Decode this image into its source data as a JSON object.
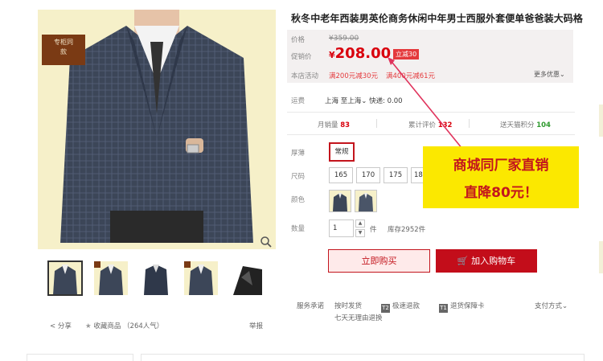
{
  "product": {
    "title": "秋冬中老年西装男英伦商务休闲中年男士西服外套便单爸爸装大码格",
    "promo_sticker_line1": "专柜同",
    "promo_sticker_line2": "款"
  },
  "price": {
    "orig_label": "价格",
    "orig_value": "¥359.00",
    "promo_label": "促销价",
    "currency": "¥",
    "promo_value": "208.00",
    "discount_badge": "立减30",
    "event_label": "本店活动",
    "event1": "满200元减30元",
    "event2": "满400元减61元",
    "more_deals": "更多优惠"
  },
  "shipping": {
    "label": "运费",
    "from": "上海",
    "to": "至上海",
    "express": "快递: 0.00"
  },
  "stats": {
    "monthly_sales_label": "月销量",
    "monthly_sales_value": "83",
    "reviews_label": "累计评价",
    "reviews_value": "132",
    "points_label": "送天猫积分",
    "points_value": "104"
  },
  "options": {
    "thickness_label": "厚薄",
    "thickness_value": "常规",
    "size_label": "尺码",
    "sizes": [
      "165",
      "170",
      "175",
      "18"
    ],
    "color_label": "颜色",
    "qty_label": "数量",
    "qty_value": "1",
    "qty_unit": "件",
    "stock": "库存2952件"
  },
  "actions": {
    "buy_now": "立即购买",
    "add_cart": "加入购物车"
  },
  "ad": {
    "line1": "商城同厂家直销",
    "line2": "直降80元！"
  },
  "service": {
    "label": "服务承诺",
    "item1": "按时发货",
    "item2": "极速退款",
    "item3": "退货保障卡",
    "item4": "七天无理由退换",
    "payment": "支付方式"
  },
  "footer": {
    "share": "分享",
    "favorite": "收藏商品",
    "favorite_count": "（264人气）",
    "report": "举报"
  },
  "colors": {
    "accent_red": "#c3151d",
    "price_red": "#d9000d",
    "ad_yellow": "#fbe800",
    "points_green": "#2e9a2e"
  }
}
